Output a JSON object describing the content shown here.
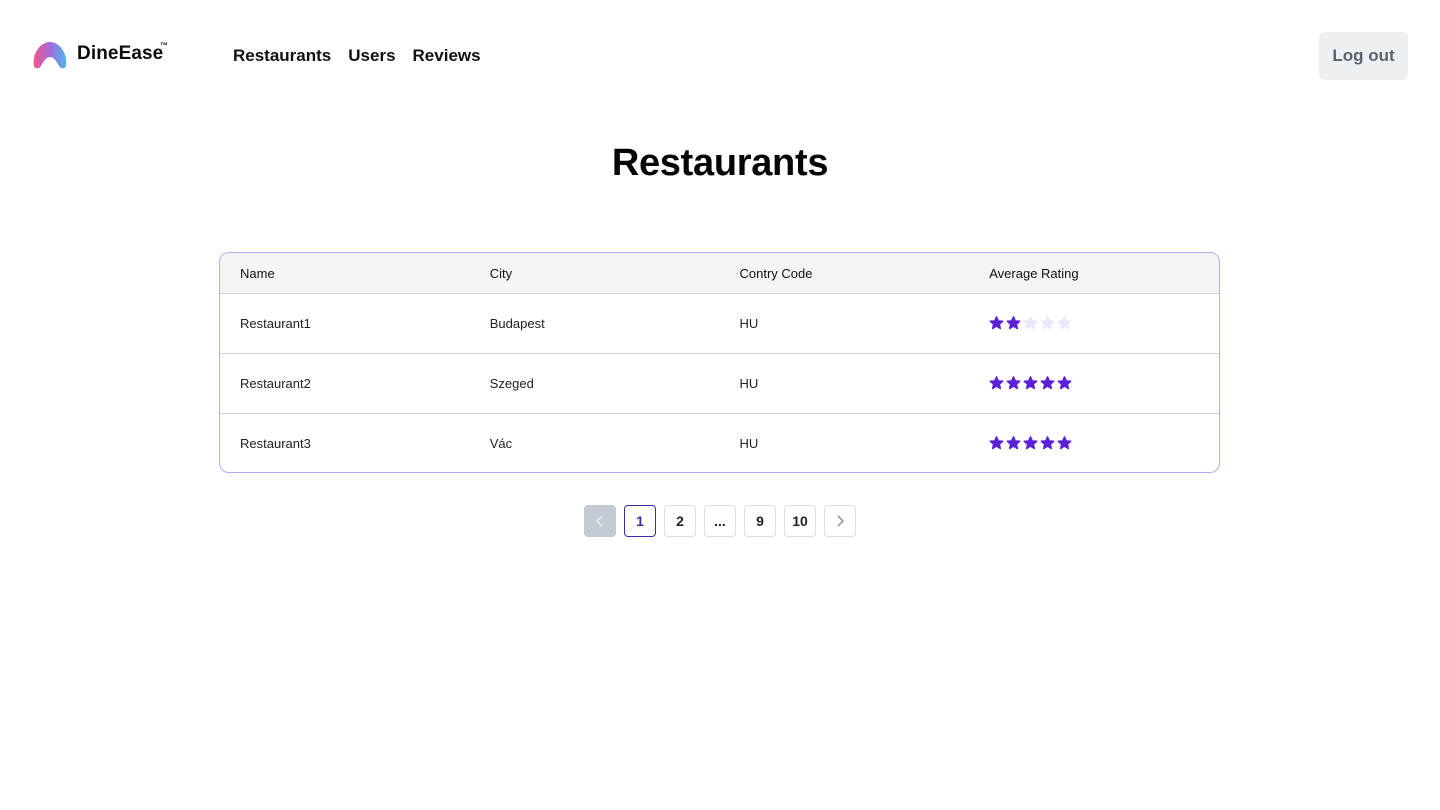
{
  "app": {
    "name": "DineEase",
    "trademark": "™"
  },
  "nav": {
    "items": [
      {
        "label": "Restaurants"
      },
      {
        "label": "Users"
      },
      {
        "label": "Reviews"
      }
    ],
    "logout_label": "Log out"
  },
  "page": {
    "title": "Restaurants"
  },
  "table": {
    "columns": [
      "Name",
      "City",
      "Contry Code",
      "Average Rating"
    ],
    "rows": [
      {
        "name": "Restaurant1",
        "city": "Budapest",
        "country_code": "HU",
        "rating": 2
      },
      {
        "name": "Restaurant2",
        "city": "Szeged",
        "country_code": "HU",
        "rating": 5
      },
      {
        "name": "Restaurant3",
        "city": "Vác",
        "country_code": "HU",
        "rating": 5
      }
    ],
    "max_rating": 5
  },
  "pagination": {
    "pages": [
      "1",
      "2",
      "...",
      "9",
      "10"
    ],
    "current": "1",
    "prev_icon": "chevron-left-icon",
    "next_icon": "chevron-right-icon"
  },
  "colors": {
    "accent": "#3a2aa8",
    "star_filled": "#5b21d6",
    "star_empty": "#ece6fb",
    "table_border": "#b6a8f5"
  }
}
